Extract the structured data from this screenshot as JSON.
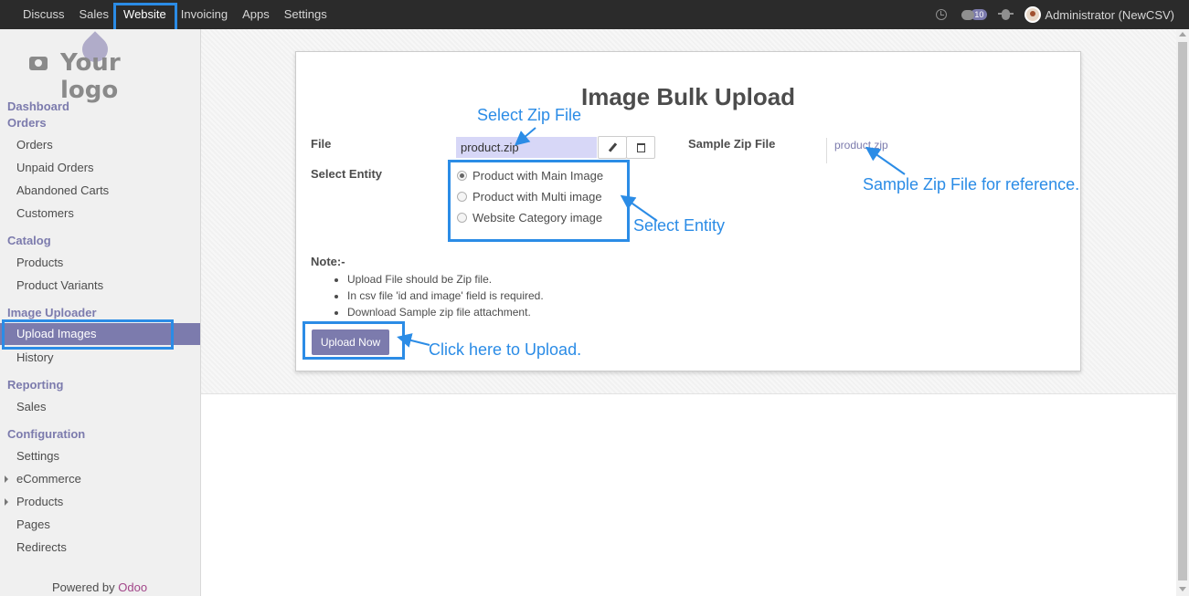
{
  "topbar": {
    "menu": [
      "Discuss",
      "Sales",
      "Website",
      "Invoicing",
      "Apps",
      "Settings"
    ],
    "active": "Website",
    "chat_count": "10",
    "user": "Administrator (NewCSV)"
  },
  "sidebar": {
    "logo_text": "Your logo",
    "sections": {
      "dashboard": "Dashboard",
      "orders": "Orders",
      "catalog": "Catalog",
      "image_uploader": "Image Uploader",
      "reporting": "Reporting",
      "configuration": "Configuration"
    },
    "items": {
      "orders": "Orders",
      "unpaid_orders": "Unpaid Orders",
      "abandoned_carts": "Abandoned Carts",
      "customers": "Customers",
      "products": "Products",
      "product_variants": "Product Variants",
      "upload_images": "Upload Images",
      "history": "History",
      "reporting_sales": "Sales",
      "settings": "Settings",
      "ecommerce": "eCommerce",
      "config_products": "Products",
      "pages": "Pages",
      "redirects": "Redirects"
    },
    "powered_by": "Powered by ",
    "powered_brand": "Odoo"
  },
  "form": {
    "title": "Image Bulk Upload",
    "file_label": "File",
    "file_value": "product.zip",
    "sample_label": "Sample Zip File",
    "sample_link": "product.zip",
    "entity_label": "Select Entity",
    "entity_options": [
      "Product with Main Image",
      "Product with Multi image",
      "Website Category image"
    ],
    "entity_selected": "Product with Main Image",
    "note_label": "Note:-",
    "notes": [
      "Upload File should be Zip file.",
      "In csv file 'id and image' field is required.",
      "Download Sample zip file attachment."
    ],
    "upload_button": "Upload Now"
  },
  "callouts": {
    "select_zip": "Select Zip File",
    "sample_ref": "Sample Zip File for reference.",
    "select_entity": "Select Entity",
    "click_upload": "Click here to Upload."
  },
  "colors": {
    "accent": "#7c7bad",
    "highlight": "#2b8ce6",
    "topbar": "#2b2b2b"
  }
}
